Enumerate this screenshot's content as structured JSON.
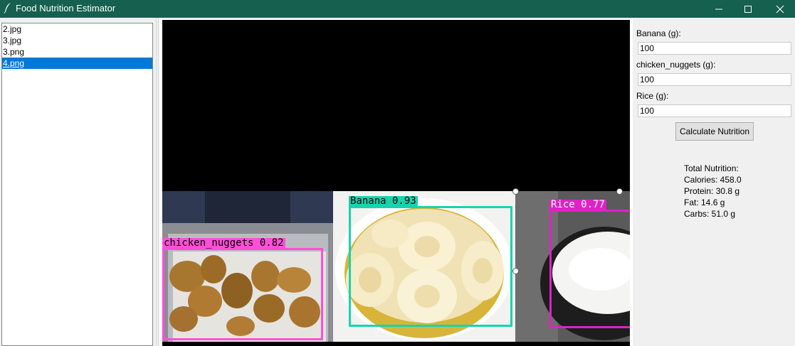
{
  "window": {
    "title": "Food Nutrition Estimator",
    "colors": {
      "titlebar": "#16604f",
      "selection": "#0078d7"
    }
  },
  "file_list": {
    "items": [
      {
        "label": "2.jpg",
        "selected": false
      },
      {
        "label": "3.jpg",
        "selected": false
      },
      {
        "label": "3.png",
        "selected": false
      },
      {
        "label": "4.png",
        "selected": true
      }
    ]
  },
  "image": {
    "detections": [
      {
        "label": "chicken_nuggets 0.82",
        "class": "chicken_nuggets",
        "confidence": 0.82,
        "color": "#ff4fd8"
      },
      {
        "label": "Banana 0.93",
        "class": "Banana",
        "confidence": 0.93,
        "color": "#16d4b0"
      },
      {
        "label": "Rice 0.77",
        "class": "Rice",
        "confidence": 0.77,
        "color": "#e021c8"
      }
    ]
  },
  "form": {
    "fields": [
      {
        "label": "Banana (g):",
        "value": "100"
      },
      {
        "label": "chicken_nuggets (g):",
        "value": "100"
      },
      {
        "label": "Rice (g):",
        "value": "100"
      }
    ],
    "calculate_label": "Calculate Nutrition"
  },
  "results": {
    "heading": "Total Nutrition:",
    "calories": "Calories: 458.0",
    "protein": "Protein: 30.8 g",
    "fat": "Fat: 14.6 g",
    "carbs": "Carbs: 51.0 g"
  }
}
